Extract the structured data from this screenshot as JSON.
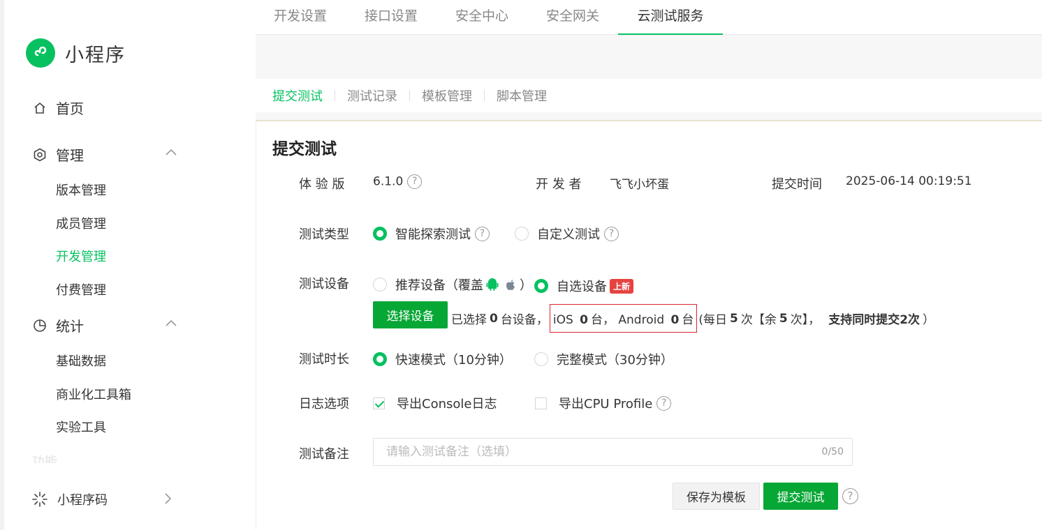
{
  "sidebar": {
    "logo_text": "小程序",
    "home": "首页",
    "manage": "管理",
    "manage_items": [
      "版本管理",
      "成员管理",
      "开发管理",
      "付费管理"
    ],
    "stats": "统计",
    "stats_items": [
      "基础数据",
      "商业化工具箱",
      "实验工具"
    ],
    "faded": "功能",
    "qrcode": "小程序码"
  },
  "topbar": {
    "tabs": [
      "开发设置",
      "接口设置",
      "安全中心",
      "安全网关",
      "云测试服务"
    ]
  },
  "subtabs": [
    "提交测试",
    "测试记录",
    "模板管理",
    "脚本管理"
  ],
  "panel": {
    "title": "提交测试",
    "version_label": "体 验 版",
    "version_value": "6.1.0",
    "developer_label": "开 发 者",
    "developer_value": "飞飞小坏蛋",
    "time_label": "提交时间",
    "time_value": "2025-06-14 00:19:51",
    "type_label": "测试类型",
    "type_smart": "智能探索测试",
    "type_custom": "自定义测试",
    "device_label": "测试设备",
    "device_recommend_pre": "推荐设备（覆盖",
    "device_recommend_post": "）",
    "device_custom": "自选设备",
    "new_badge": "上新",
    "select_button": "选择设备",
    "selected_pre": "已选择",
    "selected_count": "0",
    "selected_post": "台设备，",
    "ios_label": "iOS",
    "ios_count": "0",
    "ios_unit": "台，",
    "android_label": "Android",
    "android_count": "0",
    "android_unit": "台",
    "quota_pre": "(每日",
    "quota_daily": "5",
    "quota_mid": "次【余",
    "quota_left": "5",
    "quota_post": "次】，",
    "quota_concurrent": "支持同时提交2次",
    "quota_close": "）",
    "duration_label": "测试时长",
    "duration_fast": "快速模式（10分钟）",
    "duration_full": "完整模式（30分钟）",
    "log_label": "日志选项",
    "log_console": "导出Console日志",
    "log_cpu": "导出CPU Profile",
    "note_label": "测试备注",
    "note_placeholder": "请输入测试备注（选填）",
    "note_value": "",
    "note_counter": "0/50",
    "save_template": "保存为模板",
    "submit": "提交测试"
  },
  "colors": {
    "brand": "#07c160",
    "button": "#07a735",
    "highlight_border": "#d9262c",
    "badge": "#e64340"
  }
}
